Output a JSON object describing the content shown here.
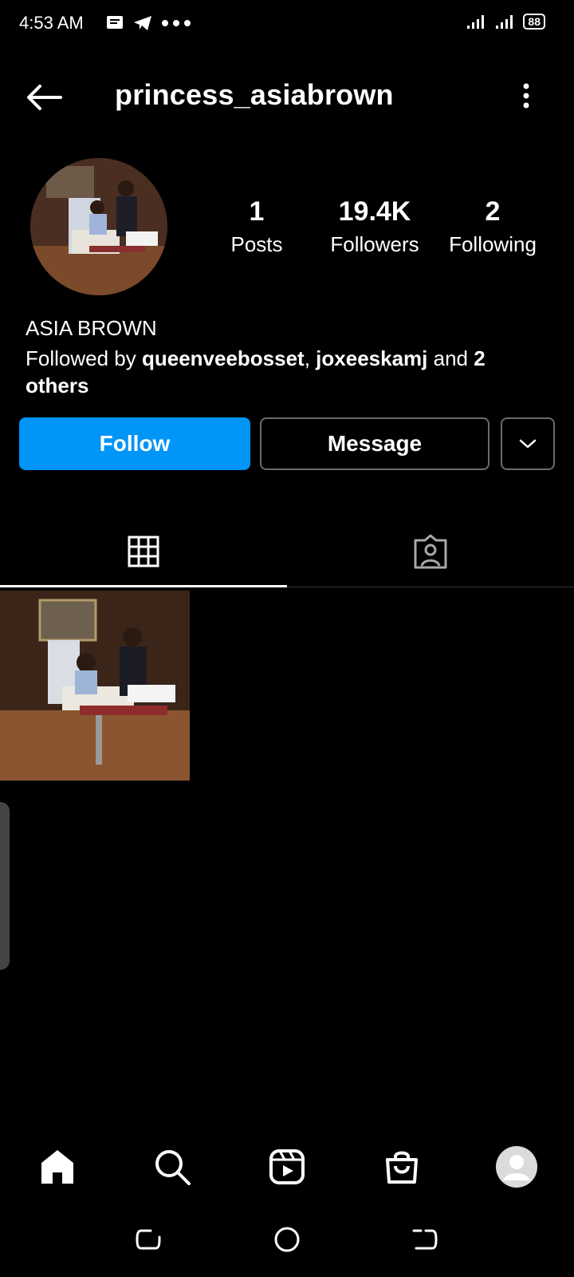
{
  "status_bar": {
    "time": "4:53 AM",
    "battery": "88",
    "left_icons": [
      "message-icon",
      "telegram-icon",
      "more-dots-icon"
    ],
    "right_icons": [
      "signal-icon",
      "signal-icon",
      "battery-icon"
    ]
  },
  "header": {
    "username": "princess_asiabrown"
  },
  "profile": {
    "stats": [
      {
        "value": "1",
        "label": "Posts"
      },
      {
        "value": "19.4K",
        "label": "Followers"
      },
      {
        "value": "2",
        "label": "Following"
      }
    ],
    "display_name": "ASIA BROWN",
    "followed_by": {
      "prefix": "Followed by ",
      "user1": "queenveebosset",
      "sep": ", ",
      "user2": "joxeeskamj",
      "and": " and ",
      "others": "2 others"
    }
  },
  "actions": {
    "follow_label": "Follow",
    "message_label": "Message"
  },
  "tabs": [
    "grid-icon",
    "tagged-icon"
  ],
  "bottom_nav": [
    "home-icon",
    "search-icon",
    "reels-icon",
    "shop-icon",
    "profile-avatar"
  ],
  "colors": {
    "background": "#000000",
    "follow_button": "#0095f6",
    "border": "#6b6b6b"
  }
}
